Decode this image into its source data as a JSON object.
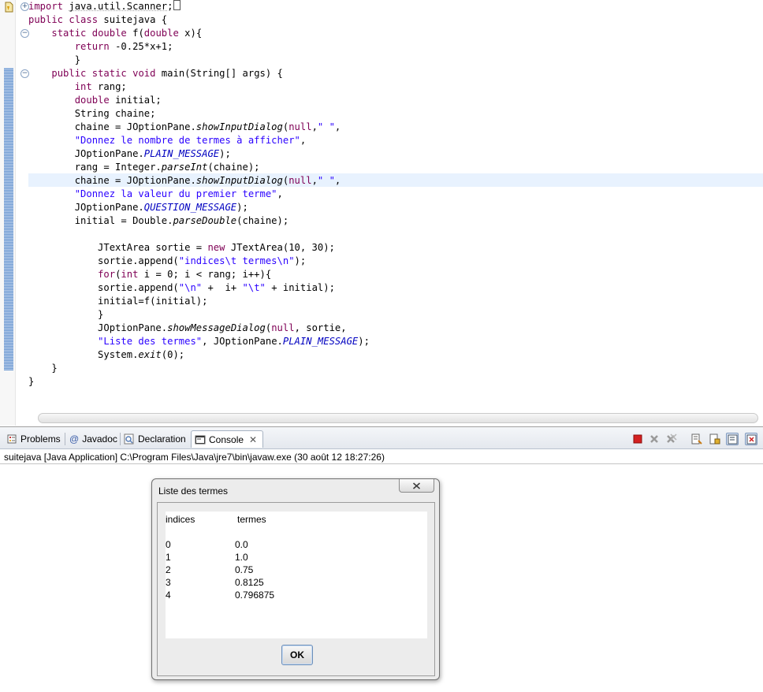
{
  "editor": {
    "lines": [
      [
        {
          "t": "import",
          "c": "kw"
        },
        {
          "t": " "
        },
        {
          "t": "java.util.Scanner",
          "c": "sq"
        },
        {
          "t": ";"
        }
      ],
      [
        {
          "t": "public",
          "c": "kw"
        },
        {
          "t": " "
        },
        {
          "t": "class",
          "c": "kw"
        },
        {
          "t": " suitejava {"
        }
      ],
      [
        {
          "t": "    "
        },
        {
          "t": "static",
          "c": "kw"
        },
        {
          "t": " "
        },
        {
          "t": "double",
          "c": "kw"
        },
        {
          "t": " f("
        },
        {
          "t": "double",
          "c": "kw"
        },
        {
          "t": " x){"
        }
      ],
      [
        {
          "t": "        "
        },
        {
          "t": "return",
          "c": "kw"
        },
        {
          "t": " -0.25*x+1;"
        }
      ],
      [
        {
          "t": "        }"
        }
      ],
      [
        {
          "t": "    "
        },
        {
          "t": "public",
          "c": "kw"
        },
        {
          "t": " "
        },
        {
          "t": "static",
          "c": "kw"
        },
        {
          "t": " "
        },
        {
          "t": "void",
          "c": "kw"
        },
        {
          "t": " main(String[] args) {"
        }
      ],
      [
        {
          "t": "        "
        },
        {
          "t": "int",
          "c": "kw"
        },
        {
          "t": " rang;"
        }
      ],
      [
        {
          "t": "        "
        },
        {
          "t": "double",
          "c": "kw"
        },
        {
          "t": " initial;"
        }
      ],
      [
        {
          "t": "        String chaine;"
        }
      ],
      [
        {
          "t": "        chaine = JOptionPane."
        },
        {
          "t": "showInputDialog",
          "c": "it"
        },
        {
          "t": "("
        },
        {
          "t": "null",
          "c": "kw"
        },
        {
          "t": ","
        },
        {
          "t": "\" \"",
          "c": "st"
        },
        {
          "t": ","
        }
      ],
      [
        {
          "t": "        "
        },
        {
          "t": "\"Donnez le nombre de termes à afficher\"",
          "c": "st"
        },
        {
          "t": ","
        }
      ],
      [
        {
          "t": "        JOptionPane."
        },
        {
          "t": "PLAIN_MESSAGE",
          "c": "sf"
        },
        {
          "t": ");"
        }
      ],
      [
        {
          "t": "        rang = Integer."
        },
        {
          "t": "parseInt",
          "c": "it"
        },
        {
          "t": "(chaine);"
        }
      ],
      [
        {
          "t": "        chaine = JOptionPane."
        },
        {
          "t": "showInputDialog",
          "c": "it"
        },
        {
          "t": "("
        },
        {
          "t": "null",
          "c": "kw"
        },
        {
          "t": ","
        },
        {
          "t": "\" \"",
          "c": "st"
        },
        {
          "t": ","
        }
      ],
      [
        {
          "t": "        "
        },
        {
          "t": "\"Donnez la valeur du premier terme\"",
          "c": "st"
        },
        {
          "t": ","
        }
      ],
      [
        {
          "t": "        JOptionPane."
        },
        {
          "t": "QUESTION_MESSAGE",
          "c": "sf"
        },
        {
          "t": ");"
        }
      ],
      [
        {
          "t": "        initial = Double."
        },
        {
          "t": "parseDouble",
          "c": "it"
        },
        {
          "t": "(chaine);"
        }
      ],
      [],
      [
        {
          "t": "            JTextArea sortie = "
        },
        {
          "t": "new",
          "c": "kw"
        },
        {
          "t": " JTextArea(10, 30);"
        }
      ],
      [
        {
          "t": "            sortie.append("
        },
        {
          "t": "\"indices\\t termes\\n\"",
          "c": "st"
        },
        {
          "t": ");"
        }
      ],
      [
        {
          "t": "            "
        },
        {
          "t": "for",
          "c": "kw"
        },
        {
          "t": "("
        },
        {
          "t": "int",
          "c": "kw"
        },
        {
          "t": " i = 0; i < rang; i++){"
        }
      ],
      [
        {
          "t": "            sortie.append("
        },
        {
          "t": "\"\\n\"",
          "c": "st"
        },
        {
          "t": " +  i+ "
        },
        {
          "t": "\"\\t\"",
          "c": "st"
        },
        {
          "t": " + initial);"
        }
      ],
      [
        {
          "t": "            initial=f(initial);"
        }
      ],
      [
        {
          "t": "            }"
        }
      ],
      [
        {
          "t": "            JOptionPane."
        },
        {
          "t": "showMessageDialog",
          "c": "it"
        },
        {
          "t": "("
        },
        {
          "t": "null",
          "c": "kw"
        },
        {
          "t": ", sortie,"
        }
      ],
      [
        {
          "t": "            "
        },
        {
          "t": "\"Liste des termes\"",
          "c": "st"
        },
        {
          "t": ", JOptionPane."
        },
        {
          "t": "PLAIN_MESSAGE",
          "c": "sf"
        },
        {
          "t": ");"
        }
      ],
      [
        {
          "t": "            System."
        },
        {
          "t": "exit",
          "c": "it"
        },
        {
          "t": "(0);"
        }
      ],
      [
        {
          "t": "    }"
        }
      ],
      [
        {
          "t": "}"
        }
      ]
    ]
  },
  "console": {
    "tabs": [
      {
        "label": "Problems",
        "icon": "problems-icon"
      },
      {
        "label": "Javadoc",
        "icon": "javadoc-icon"
      },
      {
        "label": "Declaration",
        "icon": "declaration-icon"
      },
      {
        "label": "Console",
        "icon": "console-icon",
        "active": true
      }
    ],
    "close_glyph": "✕",
    "status": "suitejava [Java Application] C:\\Program Files\\Java\\jre7\\bin\\javaw.exe (30 août 12 18:27:26)"
  },
  "dialog": {
    "title": "Liste des termes",
    "header": {
      "col1": "indices",
      "col2": "termes"
    },
    "rows": [
      {
        "i": "0",
        "v": "0.0"
      },
      {
        "i": "1",
        "v": "1.0"
      },
      {
        "i": "2",
        "v": "0.75"
      },
      {
        "i": "3",
        "v": "0.8125"
      },
      {
        "i": "4",
        "v": "0.796875"
      }
    ],
    "ok_label": "OK"
  },
  "colors": {
    "keyword": "#7f0055",
    "string": "#2a00ff",
    "static_field": "#0000c0",
    "line_highlight": "#e8f2fe"
  }
}
